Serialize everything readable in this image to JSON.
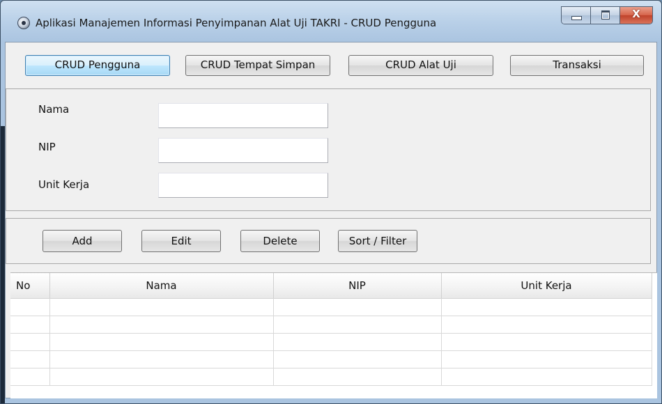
{
  "window": {
    "title": "Aplikasi Manajemen Informasi Penyimpanan Alat Uji TAKRI - CRUD Pengguna",
    "close_glyph": "X"
  },
  "nav": {
    "items": [
      {
        "label": "CRUD Pengguna",
        "active": true
      },
      {
        "label": "CRUD Tempat Simpan",
        "active": false
      },
      {
        "label": "CRUD Alat Uji",
        "active": false
      },
      {
        "label": "Transaksi",
        "active": false
      }
    ]
  },
  "form": {
    "nama_label": "Nama",
    "nama_value": "",
    "nip_label": "NIP",
    "nip_value": "",
    "unit_kerja_label": "Unit Kerja",
    "unit_kerja_value": ""
  },
  "actions": {
    "add_label": "Add",
    "edit_label": "Edit",
    "delete_label": "Delete",
    "sort_filter_label": "Sort / Filter"
  },
  "table": {
    "columns": [
      "No",
      "Nama",
      "NIP",
      "Unit Kerja"
    ],
    "rows": [
      [
        "",
        "",
        "",
        ""
      ],
      [
        "",
        "",
        "",
        ""
      ],
      [
        "",
        "",
        "",
        ""
      ],
      [
        "",
        "",
        "",
        ""
      ],
      [
        "",
        "",
        "",
        ""
      ]
    ]
  },
  "icons": {
    "app": "app-icon",
    "minimize": "minimize-icon",
    "maximize": "maximize-icon",
    "close": "close-icon"
  }
}
